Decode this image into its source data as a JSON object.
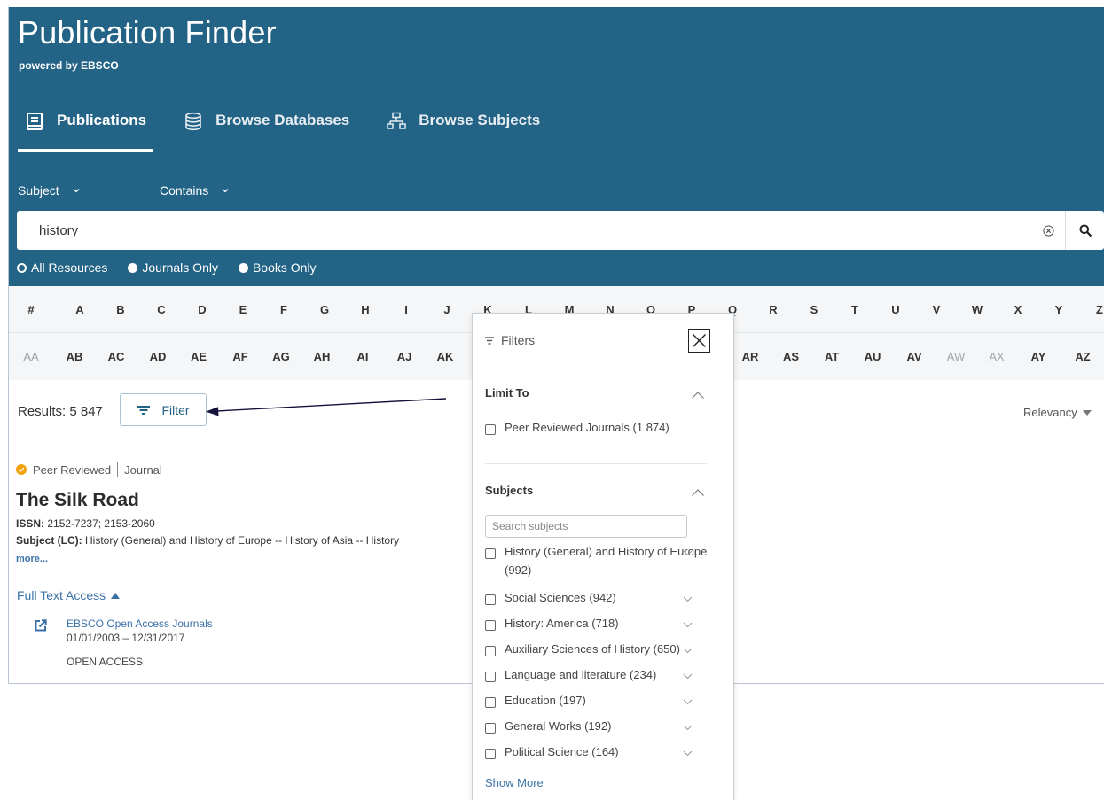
{
  "header": {
    "title": "Publication Finder",
    "subtitle": "powered by EBSCO",
    "bg_color": "#236385"
  },
  "tabs": [
    {
      "label": "Publications",
      "icon": "book-icon",
      "active": true
    },
    {
      "label": "Browse Databases",
      "icon": "database-icon",
      "active": false
    },
    {
      "label": "Browse Subjects",
      "icon": "sitemap-icon",
      "active": false
    }
  ],
  "search": {
    "field_select": "Subject",
    "match_select": "Contains",
    "query": "history"
  },
  "scope": [
    {
      "label": "All Resources",
      "selected": true
    },
    {
      "label": "Journals Only",
      "selected": false
    },
    {
      "label": "Books Only",
      "selected": false
    }
  ],
  "letters_row1": [
    "#",
    "A",
    "B",
    "C",
    "D",
    "E",
    "F",
    "G",
    "H",
    "I",
    "J",
    "K",
    "L",
    "M",
    "N",
    "O",
    "P",
    "Q",
    "R",
    "S",
    "T",
    "U",
    "V",
    "W",
    "X",
    "Y",
    "Z"
  ],
  "letters_row2": [
    "AA",
    "AB",
    "AC",
    "AD",
    "AE",
    "AF",
    "AG",
    "AH",
    "AI",
    "AJ",
    "AK",
    "AR",
    "AS",
    "AT",
    "AU",
    "AV",
    "AW",
    "AX",
    "AY",
    "AZ"
  ],
  "letters_row2_dim": [
    "AA",
    "AW",
    "AX"
  ],
  "results": {
    "count_label": "Results: 5 847",
    "filter_label": "Filter",
    "sort_label": "Relevancy"
  },
  "record": {
    "badge_peer": "Peer Reviewed",
    "badge_type": "Journal",
    "title": "The Silk Road",
    "issn_label": "ISSN:",
    "issn_value": " 2152-7237; 2153-2060",
    "subject_label": "Subject (LC):",
    "subject_value": " History (General) and History of Europe -- History of Asia -- History",
    "more_label": "more...",
    "full_text_label": "Full Text Access",
    "db_name": "EBSCO Open Access Journals",
    "db_dates": "01/01/2003 – 12/31/2017",
    "db_access": "OPEN ACCESS"
  },
  "filters": {
    "title": "Filters",
    "limit_to_title": "Limit To",
    "limit_to": [
      {
        "label": "Peer Reviewed Journals (1 874)",
        "checked": false
      }
    ],
    "subjects_title": "Subjects",
    "subjects_search_placeholder": "Search subjects",
    "subjects": [
      {
        "label": "History (General) and History of Europe (992)"
      },
      {
        "label": "Social Sciences (942)"
      },
      {
        "label": "History: America (718)"
      },
      {
        "label": "Auxiliary Sciences of History (650)"
      },
      {
        "label": "Language and literature (234)"
      },
      {
        "label": "Education (197)"
      },
      {
        "label": "General Works (192)"
      },
      {
        "label": "Political Science (164)"
      }
    ],
    "show_more_label": "Show More"
  }
}
